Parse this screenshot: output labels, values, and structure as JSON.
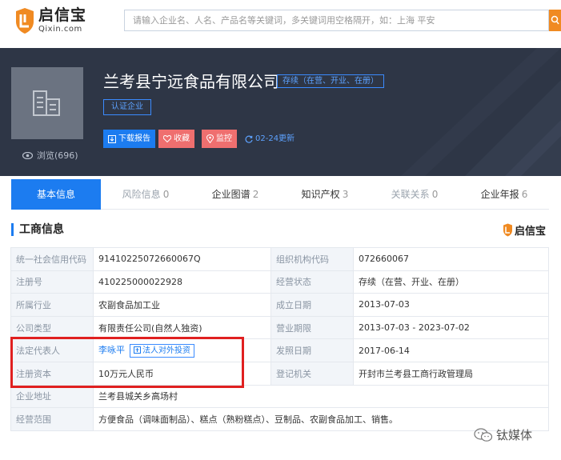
{
  "header": {
    "logo_cn": "启信宝",
    "logo_en": "Qixin.com",
    "search_placeholder": "请输入企业名、人名、产品名等关键词，多关键词用空格隔开，如：上海 平安"
  },
  "company": {
    "name": "兰考县宁远食品有限公司",
    "status": "存续（在营、开业、在册）",
    "cert": "认证企业",
    "views": "浏览(696)",
    "buttons": {
      "report": "下载报告",
      "favorite": "收藏",
      "monitor": "监控"
    },
    "update": "02-24更新"
  },
  "tabs": [
    {
      "label": "基本信息",
      "count": ""
    },
    {
      "label": "风险信息",
      "count": "0"
    },
    {
      "label": "企业图谱",
      "count": "2"
    },
    {
      "label": "知识产权",
      "count": "3"
    },
    {
      "label": "关联关系",
      "count": "0"
    },
    {
      "label": "企业年报",
      "count": "6"
    }
  ],
  "section": {
    "title": "工商信息",
    "brand": "启信宝"
  },
  "info": {
    "rows": [
      {
        "k1": "统一社会信用代码",
        "v1": "91410225072660067Q",
        "k2": "组织机构代码",
        "v2": "072660067"
      },
      {
        "k1": "注册号",
        "v1": "410225000022928",
        "k2": "经营状态",
        "v2": "存续（在营、开业、在册）"
      },
      {
        "k1": "所属行业",
        "v1": "农副食品加工业",
        "k2": "成立日期",
        "v2": "2013-07-03"
      },
      {
        "k1": "公司类型",
        "v1": "有限责任公司(自然人独资)",
        "k2": "营业期限",
        "v2": "2013-07-03 - 2023-07-02"
      },
      {
        "k1": "法定代表人",
        "v1": "李咏平",
        "tag": "法人对外投资",
        "k2": "发照日期",
        "v2": "2017-06-14"
      },
      {
        "k1": "注册资本",
        "v1": "10万元人民币",
        "k2": "登记机关",
        "v2": "开封市兰考县工商行政管理局"
      },
      {
        "k1": "企业地址",
        "v1": "兰考县城关乡高场村"
      },
      {
        "k1": "经营范围",
        "v1": "方便食品（调味面制品）、糕点（熟粉糕点）、豆制品、农副食品加工、销售。"
      }
    ]
  },
  "watermark": "钛媒体",
  "colors": {
    "brand_blue": "#1c7cf0",
    "hero_bg": "#2e3646",
    "alert_red": "#e02020",
    "pink_button": "#ef6f6f",
    "search_orange": "#f08a22"
  }
}
